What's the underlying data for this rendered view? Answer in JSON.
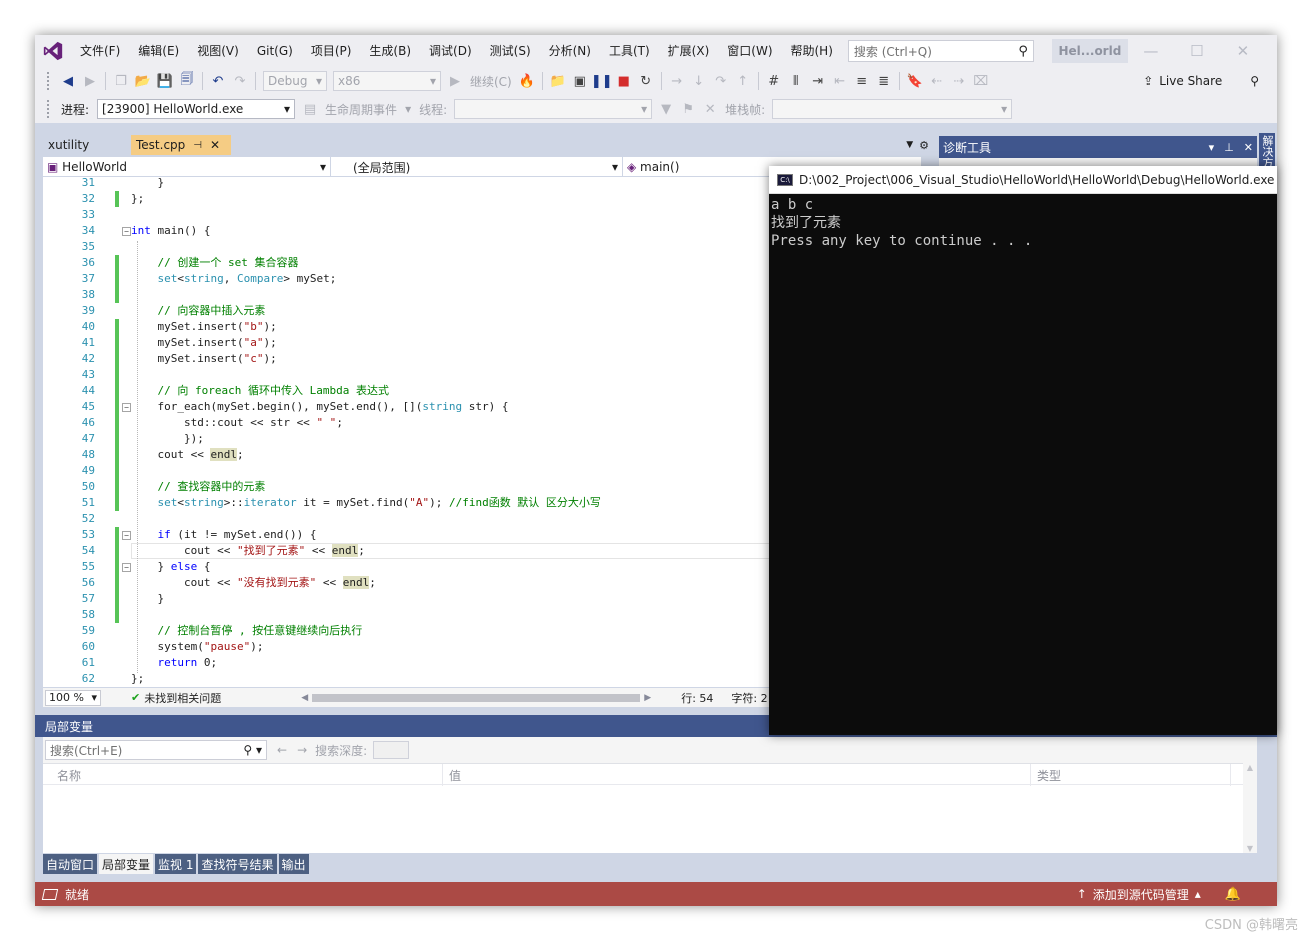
{
  "menu": {
    "items": [
      "文件(F)",
      "编辑(E)",
      "视图(V)",
      "Git(G)",
      "项目(P)",
      "生成(B)",
      "调试(D)",
      "测试(S)",
      "分析(N)",
      "工具(T)",
      "扩展(X)",
      "窗口(W)",
      "帮助(H)"
    ],
    "search_placeholder": "搜索 (Ctrl+Q)",
    "solution_title": "Hel...orld"
  },
  "toolbar1": {
    "config": "Debug",
    "platform": "x86",
    "continue_label": "继续(C)",
    "live_share": "Live Share"
  },
  "toolbar2": {
    "process_label": "进程:",
    "process_value": "[23900] HelloWorld.exe",
    "lifecycle_label": "生命周期事件",
    "thread_label": "线程:",
    "stackframe_label": "堆栈帧:"
  },
  "tabs": {
    "xutility": "xutility",
    "active": "Test.cpp"
  },
  "nav": {
    "project": "HelloWorld",
    "scope": "(全局范围)",
    "member": "main()"
  },
  "editor_status": {
    "zoom": "100 %",
    "issues": "未找到相关问题",
    "line": "行: 54",
    "col": "字符: 2"
  },
  "diagnostics": {
    "title": "诊断工具",
    "side_tab": "解决方"
  },
  "locals": {
    "title": "局部变量",
    "search_placeholder": "搜索(Ctrl+E)",
    "depth_label": "搜索深度:",
    "columns": [
      "名称",
      "值",
      "类型"
    ]
  },
  "bottom_tabs": [
    "自动窗口",
    "局部变量",
    "监视 1",
    "查找符号结果",
    "输出"
  ],
  "status": {
    "ready": "就绪",
    "scm": "添加到源代码管理"
  },
  "console": {
    "title": "D:\\002_Project\\006_Visual_Studio\\HelloWorld\\HelloWorld\\Debug\\HelloWorld.exe",
    "lines": [
      "a b c",
      "找到了元素",
      "Press any key to continue . . ."
    ]
  },
  "code_lines": [
    {
      "n": "31",
      "text": "    }"
    },
    {
      "n": "32",
      "text": "};"
    },
    {
      "n": "33",
      "text": ""
    },
    {
      "n": "34",
      "text": "int main() {"
    },
    {
      "n": "35",
      "text": ""
    },
    {
      "n": "36",
      "text": "    // 创建一个 set 集合容器"
    },
    {
      "n": "37",
      "text": "    set<string, Compare> mySet;"
    },
    {
      "n": "38",
      "text": ""
    },
    {
      "n": "39",
      "text": "    // 向容器中插入元素"
    },
    {
      "n": "40",
      "text": "    mySet.insert(\"b\");"
    },
    {
      "n": "41",
      "text": "    mySet.insert(\"a\");"
    },
    {
      "n": "42",
      "text": "    mySet.insert(\"c\");"
    },
    {
      "n": "43",
      "text": ""
    },
    {
      "n": "44",
      "text": "    // 向 foreach 循环中传入 Lambda 表达式"
    },
    {
      "n": "45",
      "text": "    for_each(mySet.begin(), mySet.end(), [](string str) {"
    },
    {
      "n": "46",
      "text": "        std::cout << str << \" \";"
    },
    {
      "n": "47",
      "text": "        });"
    },
    {
      "n": "48",
      "text": "    cout << endl;"
    },
    {
      "n": "49",
      "text": ""
    },
    {
      "n": "50",
      "text": "    // 查找容器中的元素"
    },
    {
      "n": "51",
      "text": "    set<string>::iterator it = mySet.find(\"A\"); //find函数 默认 区分大小写"
    },
    {
      "n": "52",
      "text": ""
    },
    {
      "n": "53",
      "text": "    if (it != mySet.end()) {"
    },
    {
      "n": "54",
      "text": "        cout << \"找到了元素\" << endl;"
    },
    {
      "n": "55",
      "text": "    } else {"
    },
    {
      "n": "56",
      "text": "        cout << \"没有找到元素\" << endl;"
    },
    {
      "n": "57",
      "text": "    }"
    },
    {
      "n": "58",
      "text": ""
    },
    {
      "n": "59",
      "text": "    // 控制台暂停 , 按任意键继续向后执行"
    },
    {
      "n": "60",
      "text": "    system(\"pause\");"
    },
    {
      "n": "61",
      "text": "    return 0;"
    },
    {
      "n": "62",
      "text": "};"
    }
  ],
  "watermark": "CSDN @韩曙亮"
}
